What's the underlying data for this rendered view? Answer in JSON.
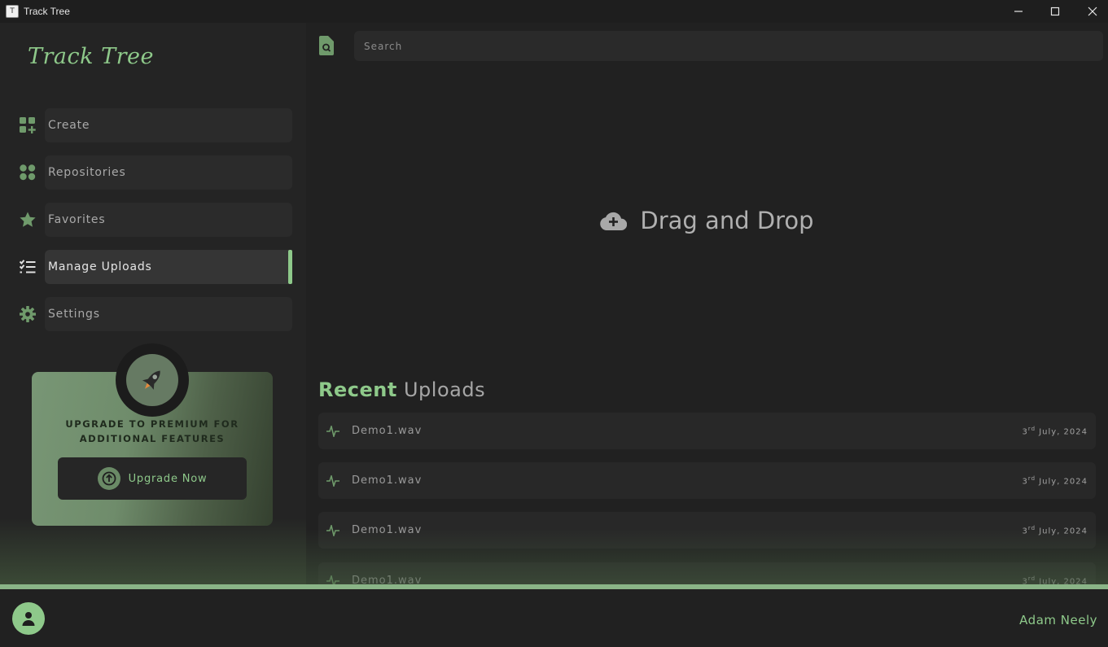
{
  "window": {
    "title": "Track Tree",
    "icon_glyph": "T"
  },
  "sidebar": {
    "logo": "Track Tree",
    "items": [
      {
        "label": "Create",
        "icon": "grid-plus-icon",
        "active": false
      },
      {
        "label": "Repositories",
        "icon": "four-dots-icon",
        "active": false
      },
      {
        "label": "Favorites",
        "icon": "star-icon",
        "active": false
      },
      {
        "label": "Manage Uploads",
        "icon": "checklist-icon",
        "active": true
      },
      {
        "label": "Settings",
        "icon": "gear-icon",
        "active": false
      }
    ],
    "premium": {
      "text": "UPGRADE TO PREMIUM FOR ADDITIONAL FEATURES",
      "button_label": "Upgrade Now"
    }
  },
  "main": {
    "search": {
      "placeholder": "Search"
    },
    "dropzone": {
      "label": "Drag and Drop"
    },
    "recent": {
      "heading_bold": "Recent",
      "heading_rest": "Uploads",
      "rows": [
        {
          "name": "Demo1.wav",
          "day": "3",
          "suffix": "rd",
          "date_rest": " July, 2024"
        },
        {
          "name": "Demo1.wav",
          "day": "3",
          "suffix": "rd",
          "date_rest": " July, 2024"
        },
        {
          "name": "Demo1.wav",
          "day": "3",
          "suffix": "rd",
          "date_rest": " July, 2024"
        },
        {
          "name": "Demo1.wav",
          "day": "3",
          "suffix": "rd",
          "date_rest": " July, 2024"
        }
      ]
    }
  },
  "footer": {
    "username": "Adam Neely"
  },
  "colors": {
    "accent": "#8ec98a",
    "background": "#212121",
    "panel": "#2b2b2b"
  }
}
